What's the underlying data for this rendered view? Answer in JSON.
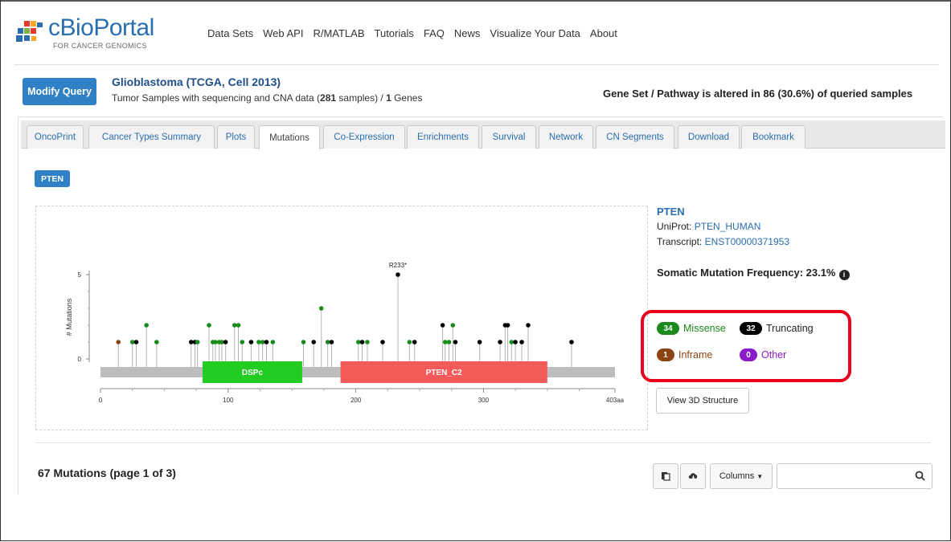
{
  "brand": {
    "name": "cBioPortal",
    "tagline": "FOR CANCER GENOMICS"
  },
  "nav": [
    "Data Sets",
    "Web API",
    "R/MATLAB",
    "Tutorials",
    "FAQ",
    "News",
    "Visualize Your Data",
    "About"
  ],
  "query": {
    "modify_label": "Modify Query",
    "study_title": "Glioblastoma (TCGA, Cell 2013)",
    "sub_pre": "Tumor Samples with sequencing and CNA data  (",
    "sub_samples": "281",
    "sub_mid": " samples) / ",
    "sub_genes": "1",
    "sub_post": " Genes",
    "altered": "Gene Set / Pathway is altered in 86 (30.6%) of queried samples"
  },
  "tabs": [
    "OncoPrint",
    "Cancer Types Summary",
    "Plots",
    "Mutations",
    "Co-Expression",
    "Enrichments",
    "Survival",
    "Network",
    "CN Segments",
    "Download",
    "Bookmark"
  ],
  "active_tab": "Mutations",
  "gene_badge": "PTEN",
  "gene_info": {
    "gene": "PTEN",
    "uniprot_label": "UniProt: ",
    "uniprot_value": "PTEN_HUMAN",
    "transcript_label": "Transcript: ",
    "transcript_value": "ENST00000371953",
    "freq_label": "Somatic Mutation Frequency: 23.1%"
  },
  "legend": {
    "missense": {
      "count": "34",
      "label": "Missense",
      "color": "#1a8a1a"
    },
    "truncating": {
      "count": "32",
      "label": "Truncating",
      "color": "#000000"
    },
    "inframe": {
      "count": "1",
      "label": "Inframe",
      "color": "#8b4513"
    },
    "other": {
      "count": "0",
      "label": "Other",
      "color": "#8a1bc9"
    }
  },
  "view3d_label": "View 3D Structure",
  "mutations_count_label": "67 Mutations (page 1 of 3)",
  "toolbar": {
    "columns_label": "Columns"
  },
  "colors": {
    "accent": "#2f80c4",
    "missense": "#1a8a1a",
    "truncating": "#000000",
    "inframe": "#8b4513",
    "highlight": "#e8001c"
  },
  "chart_data": {
    "type": "lollipop",
    "ylabel": "# Mutations",
    "yticks": [
      0,
      5
    ],
    "xticks": [
      "0",
      "100",
      "200",
      "300",
      "403aa"
    ],
    "xlim": [
      0,
      403
    ],
    "ylim": [
      0,
      5
    ],
    "protein_length": 403,
    "domains": [
      {
        "name": "DSPc",
        "start": 80,
        "end": 158,
        "color": "#22cc22"
      },
      {
        "name": "PTEN_C2",
        "start": 188,
        "end": 350,
        "color": "#f55a5a"
      }
    ],
    "annotation": {
      "label": "R233*",
      "pos": 233
    },
    "mutations": [
      {
        "pos": 14,
        "count": 1,
        "type": "inframe"
      },
      {
        "pos": 25,
        "count": 1,
        "type": "missense"
      },
      {
        "pos": 28,
        "count": 1,
        "type": "truncating"
      },
      {
        "pos": 36,
        "count": 2,
        "type": "missense"
      },
      {
        "pos": 44,
        "count": 1,
        "type": "missense"
      },
      {
        "pos": 71,
        "count": 1,
        "type": "truncating"
      },
      {
        "pos": 74,
        "count": 1,
        "type": "truncating"
      },
      {
        "pos": 76,
        "count": 1,
        "type": "missense"
      },
      {
        "pos": 85,
        "count": 2,
        "type": "missense"
      },
      {
        "pos": 88,
        "count": 1,
        "type": "missense"
      },
      {
        "pos": 90,
        "count": 1,
        "type": "missense"
      },
      {
        "pos": 93,
        "count": 1,
        "type": "missense"
      },
      {
        "pos": 95,
        "count": 1,
        "type": "missense"
      },
      {
        "pos": 98,
        "count": 1,
        "type": "truncating"
      },
      {
        "pos": 105,
        "count": 2,
        "type": "missense"
      },
      {
        "pos": 108,
        "count": 2,
        "type": "missense"
      },
      {
        "pos": 111,
        "count": 1,
        "type": "missense"
      },
      {
        "pos": 118,
        "count": 1,
        "type": "truncating"
      },
      {
        "pos": 124,
        "count": 1,
        "type": "missense"
      },
      {
        "pos": 127,
        "count": 1,
        "type": "missense"
      },
      {
        "pos": 130,
        "count": 1,
        "type": "truncating"
      },
      {
        "pos": 135,
        "count": 1,
        "type": "missense"
      },
      {
        "pos": 159,
        "count": 1,
        "type": "missense"
      },
      {
        "pos": 167,
        "count": 1,
        "type": "truncating"
      },
      {
        "pos": 173,
        "count": 3,
        "type": "missense"
      },
      {
        "pos": 178,
        "count": 1,
        "type": "missense"
      },
      {
        "pos": 181,
        "count": 1,
        "type": "truncating"
      },
      {
        "pos": 202,
        "count": 1,
        "type": "missense"
      },
      {
        "pos": 205,
        "count": 1,
        "type": "truncating"
      },
      {
        "pos": 209,
        "count": 1,
        "type": "missense"
      },
      {
        "pos": 221,
        "count": 1,
        "type": "truncating"
      },
      {
        "pos": 233,
        "count": 5,
        "type": "truncating"
      },
      {
        "pos": 242,
        "count": 1,
        "type": "missense"
      },
      {
        "pos": 246,
        "count": 1,
        "type": "truncating"
      },
      {
        "pos": 268,
        "count": 2,
        "type": "truncating"
      },
      {
        "pos": 270,
        "count": 1,
        "type": "missense"
      },
      {
        "pos": 273,
        "count": 1,
        "type": "missense"
      },
      {
        "pos": 276,
        "count": 2,
        "type": "missense"
      },
      {
        "pos": 278,
        "count": 1,
        "type": "truncating"
      },
      {
        "pos": 297,
        "count": 1,
        "type": "truncating"
      },
      {
        "pos": 313,
        "count": 1,
        "type": "truncating"
      },
      {
        "pos": 317,
        "count": 2,
        "type": "truncating"
      },
      {
        "pos": 319,
        "count": 2,
        "type": "truncating"
      },
      {
        "pos": 322,
        "count": 1,
        "type": "missense"
      },
      {
        "pos": 325,
        "count": 1,
        "type": "truncating"
      },
      {
        "pos": 330,
        "count": 1,
        "type": "truncating"
      },
      {
        "pos": 335,
        "count": 2,
        "type": "truncating"
      },
      {
        "pos": 369,
        "count": 1,
        "type": "truncating"
      }
    ]
  }
}
